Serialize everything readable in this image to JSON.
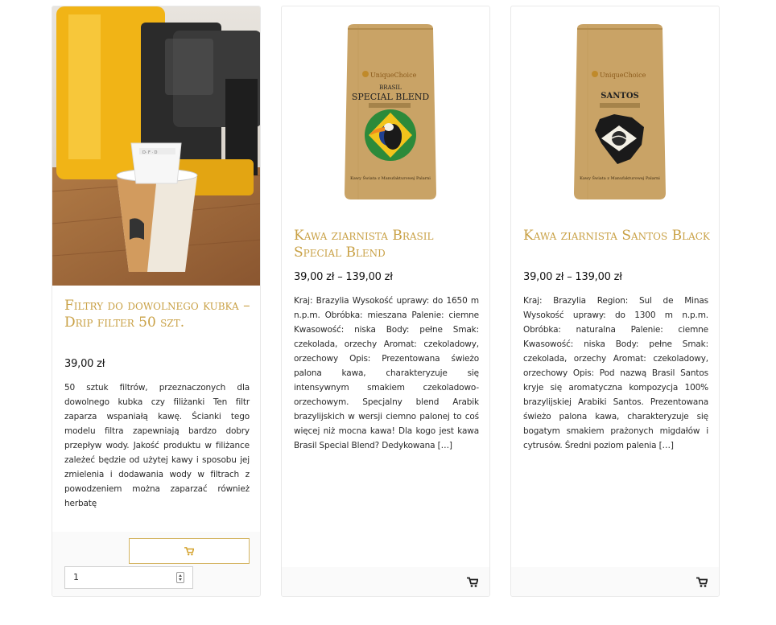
{
  "products": [
    {
      "title": "Filtry do dowolnego kubka – Drip filter 50 szt.",
      "price": "39,00 zł",
      "description": "50 sztuk filtrów, przeznaczonych dla dowolnego kubka czy filiżanki Ten filtr zaparza wspaniałą kawę. Ścianki tego modelu filtra zapewniają bardzo dobry przepływ wody. Jakość produktu w filiżance zależeć będzie od użytej kawy i sposobu jej zmielenia i dodawania wody w filtrach z powodzeniem można zaparzać również herbatę",
      "quantity": "1",
      "cart_icon": "cart-icon",
      "accent": "#d4b461"
    },
    {
      "title": "Kawa ziarnista Brasil Special Blend",
      "price": "39,00 zł – 139,00 zł",
      "description": "Kraj: Brazylia Wysokość uprawy: do 1650 m n.p.m. Obróbka: mieszana Palenie: ciemne Kwasowość: niska Body: pełne Smak: czekolada, orzechy Aromat: czekoladowy, orzechowy Opis: Prezentowana świeżo palona kawa, charakteryzuje się intensywnym smakiem czekoladowo-orzechowym. Specjalny blend Arabik brazylijskich w wersji ciemno palonej to coś więcej niż mocna kawa! Dla kogo jest kawa Brasil Special Blend?  Dedykowana […]",
      "bag_brand": "UniqueChoice",
      "bag_line1": "BRASIL",
      "bag_line2": "SPECIAL BLEND",
      "bag_footer": "Kawy Świata z Manufakturowej Palarni",
      "cart_icon": "cart-icon"
    },
    {
      "title": "Kawa ziarnista Santos Black",
      "price": "39,00 zł – 139,00 zł",
      "description": "Kraj: Brazylia Region: Sul de Minas Wysokość uprawy: do 1300 m n.p.m. Obróbka: naturalna Palenie: ciemne Kwasowość: niska Body: pełne Smak: czekolada, orzechy Aromat: czekoladowy, orzechowy Opis: Pod nazwą Brasil Santos kryje się aromatyczna kompozycja 100% brazylijskiej Arabiki Santos. Prezentowana świeżo palona kawa, charakteryzuje się bogatym smakiem prażonych migdałów i cytrusów. Średni poziom palenia […]",
      "bag_brand": "UniqueChoice",
      "bag_line1": "SANTOS",
      "bag_footer": "Kawy Świata z Manufakturowej Palarni",
      "cart_icon": "cart-icon"
    }
  ],
  "colors": {
    "title_gold": "#c9a146",
    "button_border": "#d4b461",
    "footer_bg": "#fafafa",
    "kraft_bag": "#c9a366"
  }
}
